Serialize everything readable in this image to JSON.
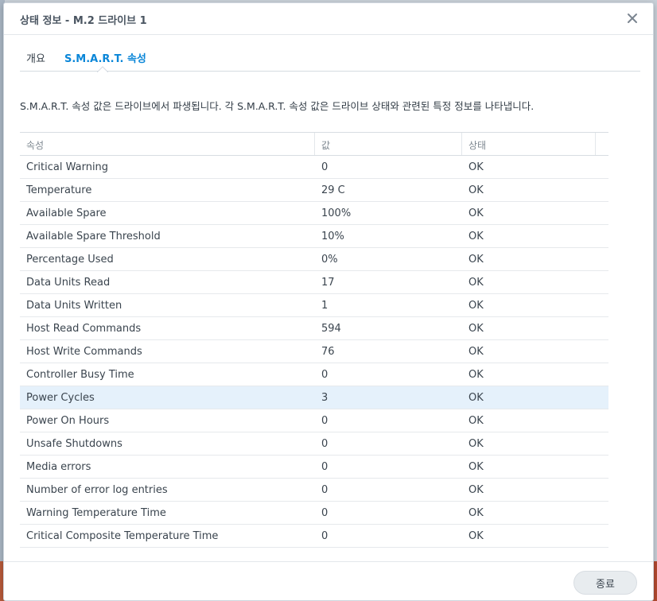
{
  "dialog": {
    "title": "상태 정보 - M.2 드라이브 1"
  },
  "tabs": [
    {
      "label": "개요",
      "active": false
    },
    {
      "label": "S.M.A.R.T. 속성",
      "active": true
    }
  ],
  "description": "S.M.A.R.T. 속성 값은 드라이브에서 파생됩니다. 각 S.M.A.R.T. 속성 값은 드라이브 상태와 관련된 특정 정보를 나타냅니다.",
  "table": {
    "headers": [
      "속성",
      "값",
      "상태"
    ],
    "rows": [
      {
        "attribute": "Critical Warning",
        "value": "0",
        "status": "OK"
      },
      {
        "attribute": "Temperature",
        "value": "29 C",
        "status": "OK"
      },
      {
        "attribute": "Available Spare",
        "value": "100%",
        "status": "OK"
      },
      {
        "attribute": "Available Spare Threshold",
        "value": "10%",
        "status": "OK"
      },
      {
        "attribute": "Percentage Used",
        "value": "0%",
        "status": "OK"
      },
      {
        "attribute": "Data Units Read",
        "value": "17",
        "status": "OK"
      },
      {
        "attribute": "Data Units Written",
        "value": "1",
        "status": "OK"
      },
      {
        "attribute": "Host Read Commands",
        "value": "594",
        "status": "OK"
      },
      {
        "attribute": "Host Write Commands",
        "value": "76",
        "status": "OK"
      },
      {
        "attribute": "Controller Busy Time",
        "value": "0",
        "status": "OK"
      },
      {
        "attribute": "Power Cycles",
        "value": "3",
        "status": "OK",
        "selected": true
      },
      {
        "attribute": "Power On Hours",
        "value": "0",
        "status": "OK"
      },
      {
        "attribute": "Unsafe Shutdowns",
        "value": "0",
        "status": "OK"
      },
      {
        "attribute": "Media errors",
        "value": "0",
        "status": "OK"
      },
      {
        "attribute": "Number of error log entries",
        "value": "0",
        "status": "OK"
      },
      {
        "attribute": "Warning Temperature Time",
        "value": "0",
        "status": "OK"
      },
      {
        "attribute": "Critical Composite Temperature Time",
        "value": "0",
        "status": "OK"
      }
    ]
  },
  "footer": {
    "close_label": "종료"
  },
  "icons": {
    "close": "close-icon",
    "tab_caret": "caret-up-icon"
  },
  "colors": {
    "accent": "#0a86d8",
    "selected_row": "#e5f1fb"
  }
}
